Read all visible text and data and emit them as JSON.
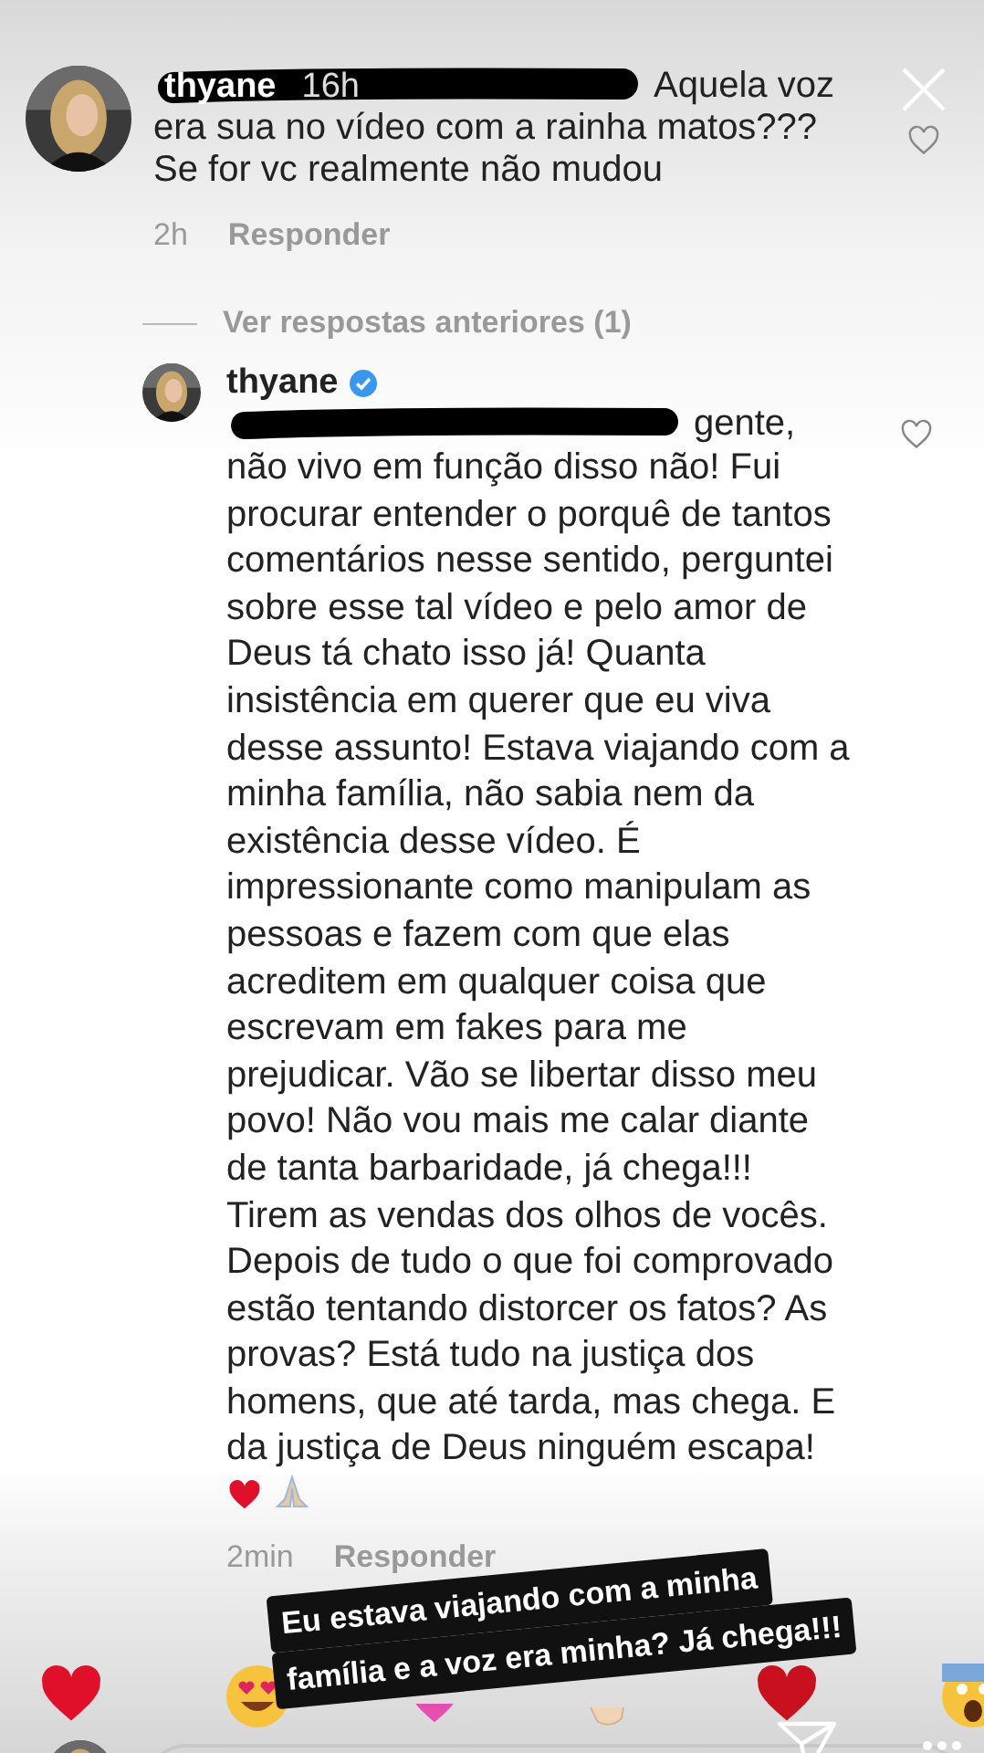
{
  "comment": {
    "username": "thyane",
    "time": "16h",
    "text_start": "Aquela voz",
    "text": "era sua no vídeo com a rainha matos??? Se for vc realmente não mudou",
    "age": "2h",
    "reply_label": "Responder"
  },
  "view_replies": "Ver respostas anteriores (1)",
  "reply": {
    "username": "thyane",
    "verified": true,
    "text_start": "gente,",
    "text": "não vivo em função disso não! Fui procurar entender o porquê de tantos comentários nesse sentido, perguntei sobre esse tal vídeo e pelo amor de Deus tá chato isso já! Quanta insistência em querer que eu viva desse assunto! Estava viajando com a minha família, não sabia nem da existência desse vídeo. É impressionante como manipulam as pessoas e fazem com que elas acreditem em qualquer coisa que escrevam em fakes para me prejudicar. Vão se libertar disso meu povo! Não vou mais me calar diante de tanta barbaridade, já chega!!! Tirem as vendas dos olhos de vocês. Depois de tudo o que foi comprovado estão tentando distorcer os fatos? As provas? Está tudo na justiça dos homens, que até tarda, mas chega. E da justiça de Deus ninguém escapa!",
    "age": "2min",
    "reply_label": "Responder"
  },
  "sticker": {
    "lines": [
      "Eu estava viajando com a minha",
      "família e a voz era minha? Já chega!!!"
    ]
  }
}
